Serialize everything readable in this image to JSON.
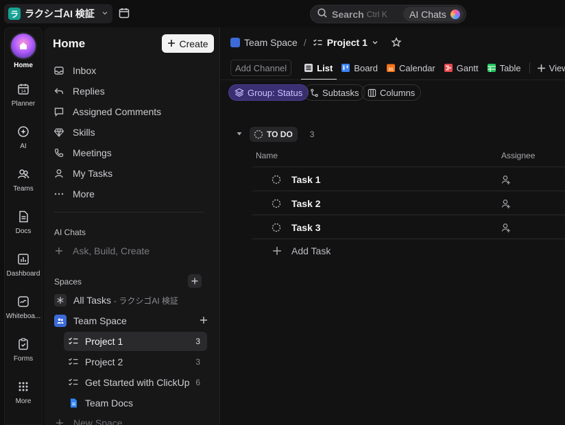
{
  "workspace": {
    "logo_letter": "ラ",
    "name": "ラクシゴAI 検証"
  },
  "search": {
    "label": "Search",
    "shortcut": "Ctrl K",
    "ai_chats": "AI Chats"
  },
  "rail": [
    {
      "label": "Home"
    },
    {
      "label": "Planner"
    },
    {
      "label": "AI"
    },
    {
      "label": "Teams"
    },
    {
      "label": "Docs"
    },
    {
      "label": "Dashboard"
    },
    {
      "label": "Whiteboa..."
    },
    {
      "label": "Forms"
    },
    {
      "label": "More"
    }
  ],
  "planner_day": "14",
  "sidebar": {
    "title": "Home",
    "create_label": "Create",
    "items": [
      {
        "label": "Inbox",
        "icon": "inbox-icon"
      },
      {
        "label": "Replies",
        "icon": "reply-icon"
      },
      {
        "label": "Assigned Comments",
        "icon": "comment-icon"
      },
      {
        "label": "Skills",
        "icon": "diamond-icon"
      },
      {
        "label": "Meetings",
        "icon": "phone-icon"
      },
      {
        "label": "My Tasks",
        "icon": "person-icon"
      },
      {
        "label": "More",
        "icon": "ellipsis-icon"
      }
    ],
    "ai_chats_title": "AI Chats",
    "ai_chats_prompt": "Ask, Build, Create",
    "spaces_title": "Spaces",
    "all_tasks": {
      "label": "All Tasks",
      "suffix": "- ラクシゴAI 検証"
    },
    "team_space": "Team Space",
    "lists": [
      {
        "label": "Project 1",
        "count": "3"
      },
      {
        "label": "Project 2",
        "count": "3"
      },
      {
        "label": "Get Started with ClickUp",
        "count": "6"
      }
    ],
    "team_docs": "Team Docs",
    "new_space": "New Space"
  },
  "main": {
    "breadcrumb": {
      "space": "Team Space",
      "sep": "/",
      "project": "Project 1"
    },
    "add_channel": "Add Channel",
    "tabs": [
      {
        "label": "List",
        "color": "#cfcfd3"
      },
      {
        "label": "Board",
        "color": "#3b82f6"
      },
      {
        "label": "Calendar",
        "color": "#f97316",
        "badge": "31"
      },
      {
        "label": "Gantt",
        "color": "#e5484d"
      },
      {
        "label": "Table",
        "color": "#22c55e"
      }
    ],
    "add_view": "View",
    "chips": {
      "group": "Group: Status",
      "subtasks": "Subtasks",
      "columns": "Columns"
    },
    "group": {
      "status": "TO DO",
      "count": "3"
    },
    "columns": {
      "name": "Name",
      "assignee": "Assignee"
    },
    "tasks": [
      {
        "name": "Task 1"
      },
      {
        "name": "Task 2"
      },
      {
        "name": "Task 3"
      }
    ],
    "add_task": "Add Task"
  }
}
